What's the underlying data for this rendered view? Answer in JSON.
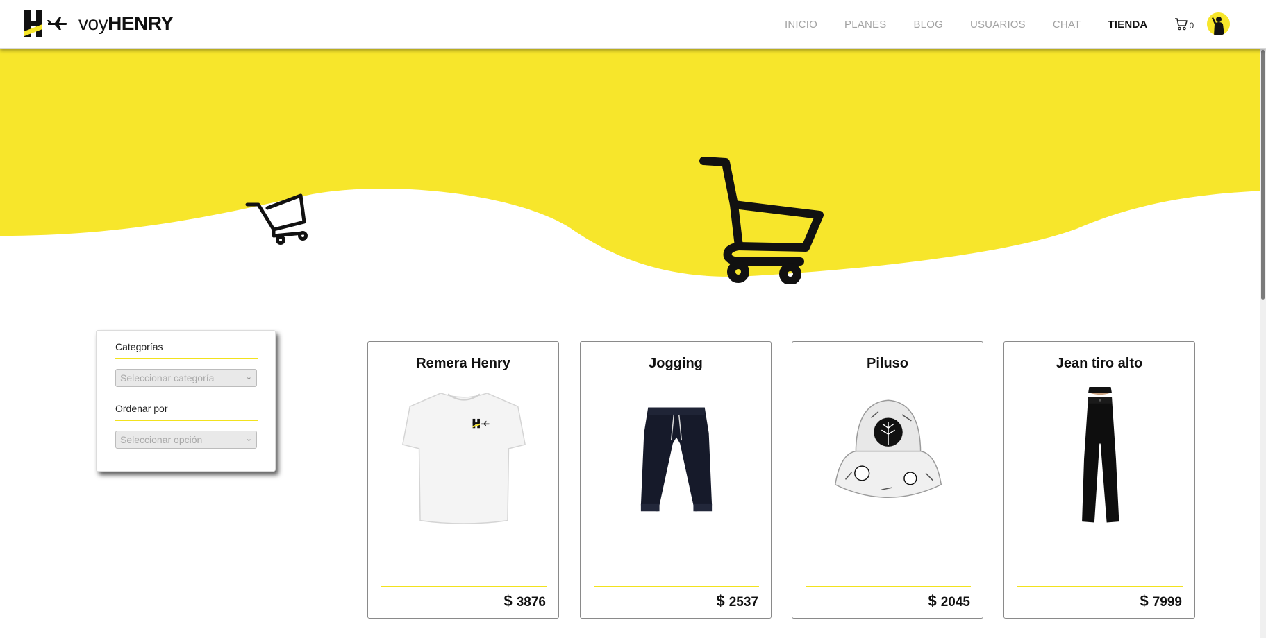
{
  "brand": {
    "prefix": "voy",
    "name": "HENRY"
  },
  "nav": {
    "items": [
      {
        "label": "INICIO",
        "active": false
      },
      {
        "label": "PLANES",
        "active": false
      },
      {
        "label": "BLOG",
        "active": false
      },
      {
        "label": "USUARIOS",
        "active": false
      },
      {
        "label": "CHAT",
        "active": false
      },
      {
        "label": "TIENDA",
        "active": true
      }
    ],
    "cart_count": "0"
  },
  "filters": {
    "category_label": "Categorías",
    "category_placeholder": "Seleccionar categoría",
    "order_label": "Ordenar por",
    "order_placeholder": "Seleccionar opción"
  },
  "products": [
    {
      "title": "Remera Henry",
      "currency": "$",
      "price": "3876",
      "icon": "t-shirt-image"
    },
    {
      "title": "Jogging",
      "currency": "$",
      "price": "2537",
      "icon": "jogging-pants-image"
    },
    {
      "title": "Piluso",
      "currency": "$",
      "price": "2045",
      "icon": "bucket-hat-image"
    },
    {
      "title": "Jean tiro alto",
      "currency": "$",
      "price": "7999",
      "icon": "high-waist-jeans-image"
    }
  ],
  "colors": {
    "accent": "#f7e62b",
    "nav_inactive": "#a2a2a2",
    "text": "#111111"
  }
}
